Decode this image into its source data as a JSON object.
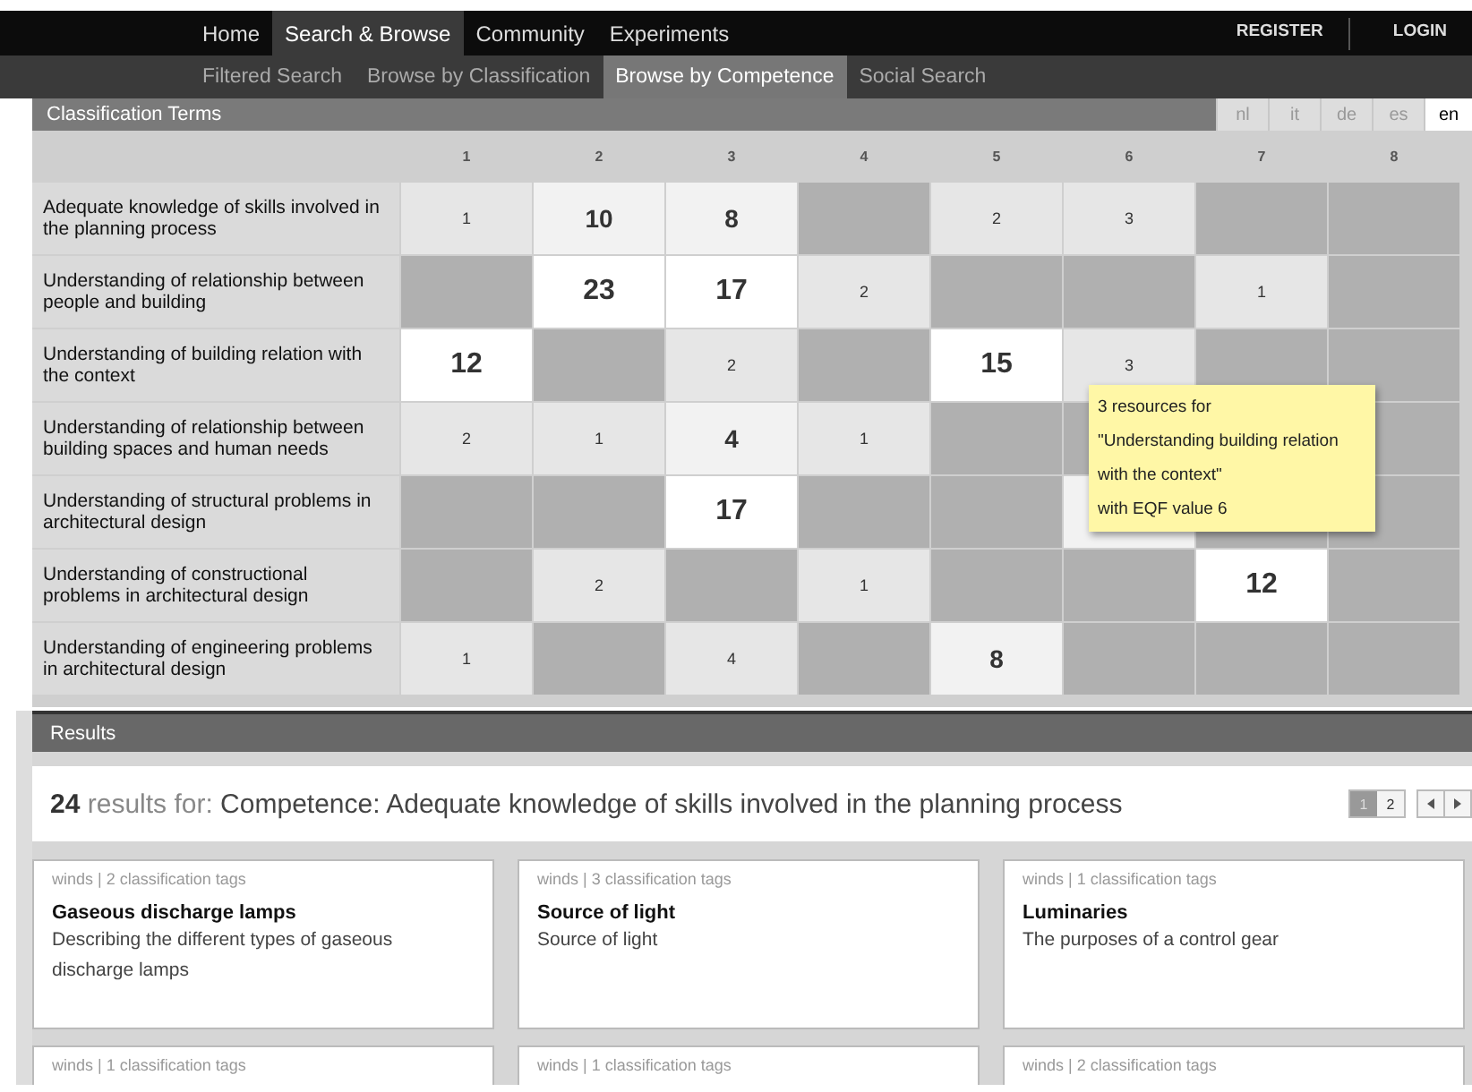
{
  "nav": {
    "items": [
      {
        "label": "Home",
        "selected": false
      },
      {
        "label": "Search & Browse",
        "selected": true
      },
      {
        "label": "Community",
        "selected": false
      },
      {
        "label": "Experiments",
        "selected": false
      }
    ],
    "account": [
      "REGISTER",
      "LOGIN"
    ]
  },
  "subnav": [
    {
      "label": "Filtered Search",
      "selected": false
    },
    {
      "label": "Browse by Classification",
      "selected": false
    },
    {
      "label": "Browse by Competence",
      "selected": true
    },
    {
      "label": "Social Search",
      "selected": false
    }
  ],
  "classification": {
    "title": "Classification Terms",
    "languages": [
      {
        "label": "nl",
        "selected": false
      },
      {
        "label": "it",
        "selected": false
      },
      {
        "label": "de",
        "selected": false
      },
      {
        "label": "es",
        "selected": false
      },
      {
        "label": "en",
        "selected": true
      }
    ]
  },
  "grid": {
    "columns": [
      "1",
      "2",
      "3",
      "4",
      "5",
      "6",
      "7",
      "8"
    ],
    "rows": [
      {
        "label": "Adequate knowledge of skills involved in the planning process",
        "cells": [
          {
            "kind": "small",
            "value": "1"
          },
          {
            "kind": "medium",
            "value": "10"
          },
          {
            "kind": "medium",
            "value": "8"
          },
          {
            "kind": "empty"
          },
          {
            "kind": "small",
            "value": "2"
          },
          {
            "kind": "small",
            "value": "3"
          },
          {
            "kind": "empty"
          },
          {
            "kind": "empty"
          }
        ]
      },
      {
        "label": "Understanding of relationship between people and building",
        "cells": [
          {
            "kind": "empty"
          },
          {
            "kind": "large",
            "value": "23"
          },
          {
            "kind": "large",
            "value": "17"
          },
          {
            "kind": "small",
            "value": "2"
          },
          {
            "kind": "empty"
          },
          {
            "kind": "empty"
          },
          {
            "kind": "small",
            "value": "1"
          },
          {
            "kind": "empty"
          }
        ]
      },
      {
        "label": "Understanding of building relation with the context",
        "cells": [
          {
            "kind": "large",
            "value": "12"
          },
          {
            "kind": "empty"
          },
          {
            "kind": "small",
            "value": "2"
          },
          {
            "kind": "empty"
          },
          {
            "kind": "large",
            "value": "15"
          },
          {
            "kind": "small",
            "value": "3"
          },
          {
            "kind": "empty"
          },
          {
            "kind": "empty"
          }
        ]
      },
      {
        "label": "Understanding of relationship between building spaces and human needs",
        "cells": [
          {
            "kind": "small",
            "value": "2"
          },
          {
            "kind": "small",
            "value": "1"
          },
          {
            "kind": "medium",
            "value": "4"
          },
          {
            "kind": "small",
            "value": "1"
          },
          {
            "kind": "empty"
          },
          {
            "kind": "empty"
          },
          {
            "kind": "covered"
          },
          {
            "kind": "empty"
          }
        ]
      },
      {
        "label": "Understanding of structural problems in architectural design",
        "cells": [
          {
            "kind": "empty"
          },
          {
            "kind": "empty"
          },
          {
            "kind": "large",
            "value": "17"
          },
          {
            "kind": "empty"
          },
          {
            "kind": "empty"
          },
          {
            "kind": "blank"
          },
          {
            "kind": "empty"
          },
          {
            "kind": "empty"
          }
        ]
      },
      {
        "label": "Understanding of constructional problems in architectural design",
        "cells": [
          {
            "kind": "empty"
          },
          {
            "kind": "small",
            "value": "2"
          },
          {
            "kind": "empty"
          },
          {
            "kind": "small",
            "value": "1"
          },
          {
            "kind": "empty"
          },
          {
            "kind": "empty"
          },
          {
            "kind": "large",
            "value": "12"
          },
          {
            "kind": "empty"
          }
        ]
      },
      {
        "label": "Understanding of engineering problems in architectural design",
        "cells": [
          {
            "kind": "small",
            "value": "1"
          },
          {
            "kind": "empty"
          },
          {
            "kind": "small",
            "value": "4"
          },
          {
            "kind": "empty"
          },
          {
            "kind": "medium",
            "value": "8"
          },
          {
            "kind": "empty"
          },
          {
            "kind": "empty"
          },
          {
            "kind": "empty"
          }
        ]
      }
    ]
  },
  "tooltip": {
    "lines": [
      "3 resources for",
      "\"Understanding building relation",
      "with the context\"",
      "with EQF value 6"
    ]
  },
  "results": {
    "title": "Results",
    "count": "24",
    "count_label": "results for:",
    "query": "Competence: Adequate knowledge of skills involved in the planning process",
    "pages": [
      {
        "label": "1",
        "selected": true
      },
      {
        "label": "2",
        "selected": false
      }
    ],
    "cards": [
      {
        "meta": "winds | 2 classification tags",
        "title": "Gaseous discharge lamps",
        "description": "Describing the different types of gaseous discharge lamps"
      },
      {
        "meta": "winds | 3 classification tags",
        "title": "Source of light",
        "description": "Source of light"
      },
      {
        "meta": "winds | 1 classification tags",
        "title": "Luminaries",
        "description": "The purposes of a control gear"
      },
      {
        "meta": "winds | 1 classification tags"
      },
      {
        "meta": "winds | 1 classification tags"
      },
      {
        "meta": "winds | 2 classification tags"
      }
    ]
  }
}
